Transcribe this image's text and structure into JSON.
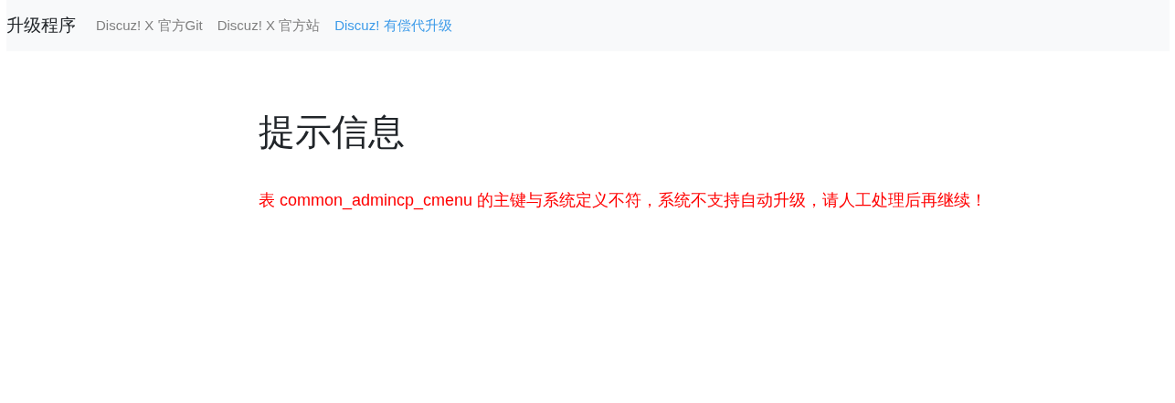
{
  "navbar": {
    "brand": "升级程序",
    "links": [
      {
        "label": "Discuz! X 官方Git",
        "highlighted": false
      },
      {
        "label": "Discuz! X 官方站",
        "highlighted": false
      },
      {
        "label": "Discuz! 有偿代升级",
        "highlighted": true
      }
    ]
  },
  "title": "提示信息",
  "message": "表 common_admincp_cmenu 的主键与系统定义不符，系统不支持自动升级，请人工处理后再继续！"
}
